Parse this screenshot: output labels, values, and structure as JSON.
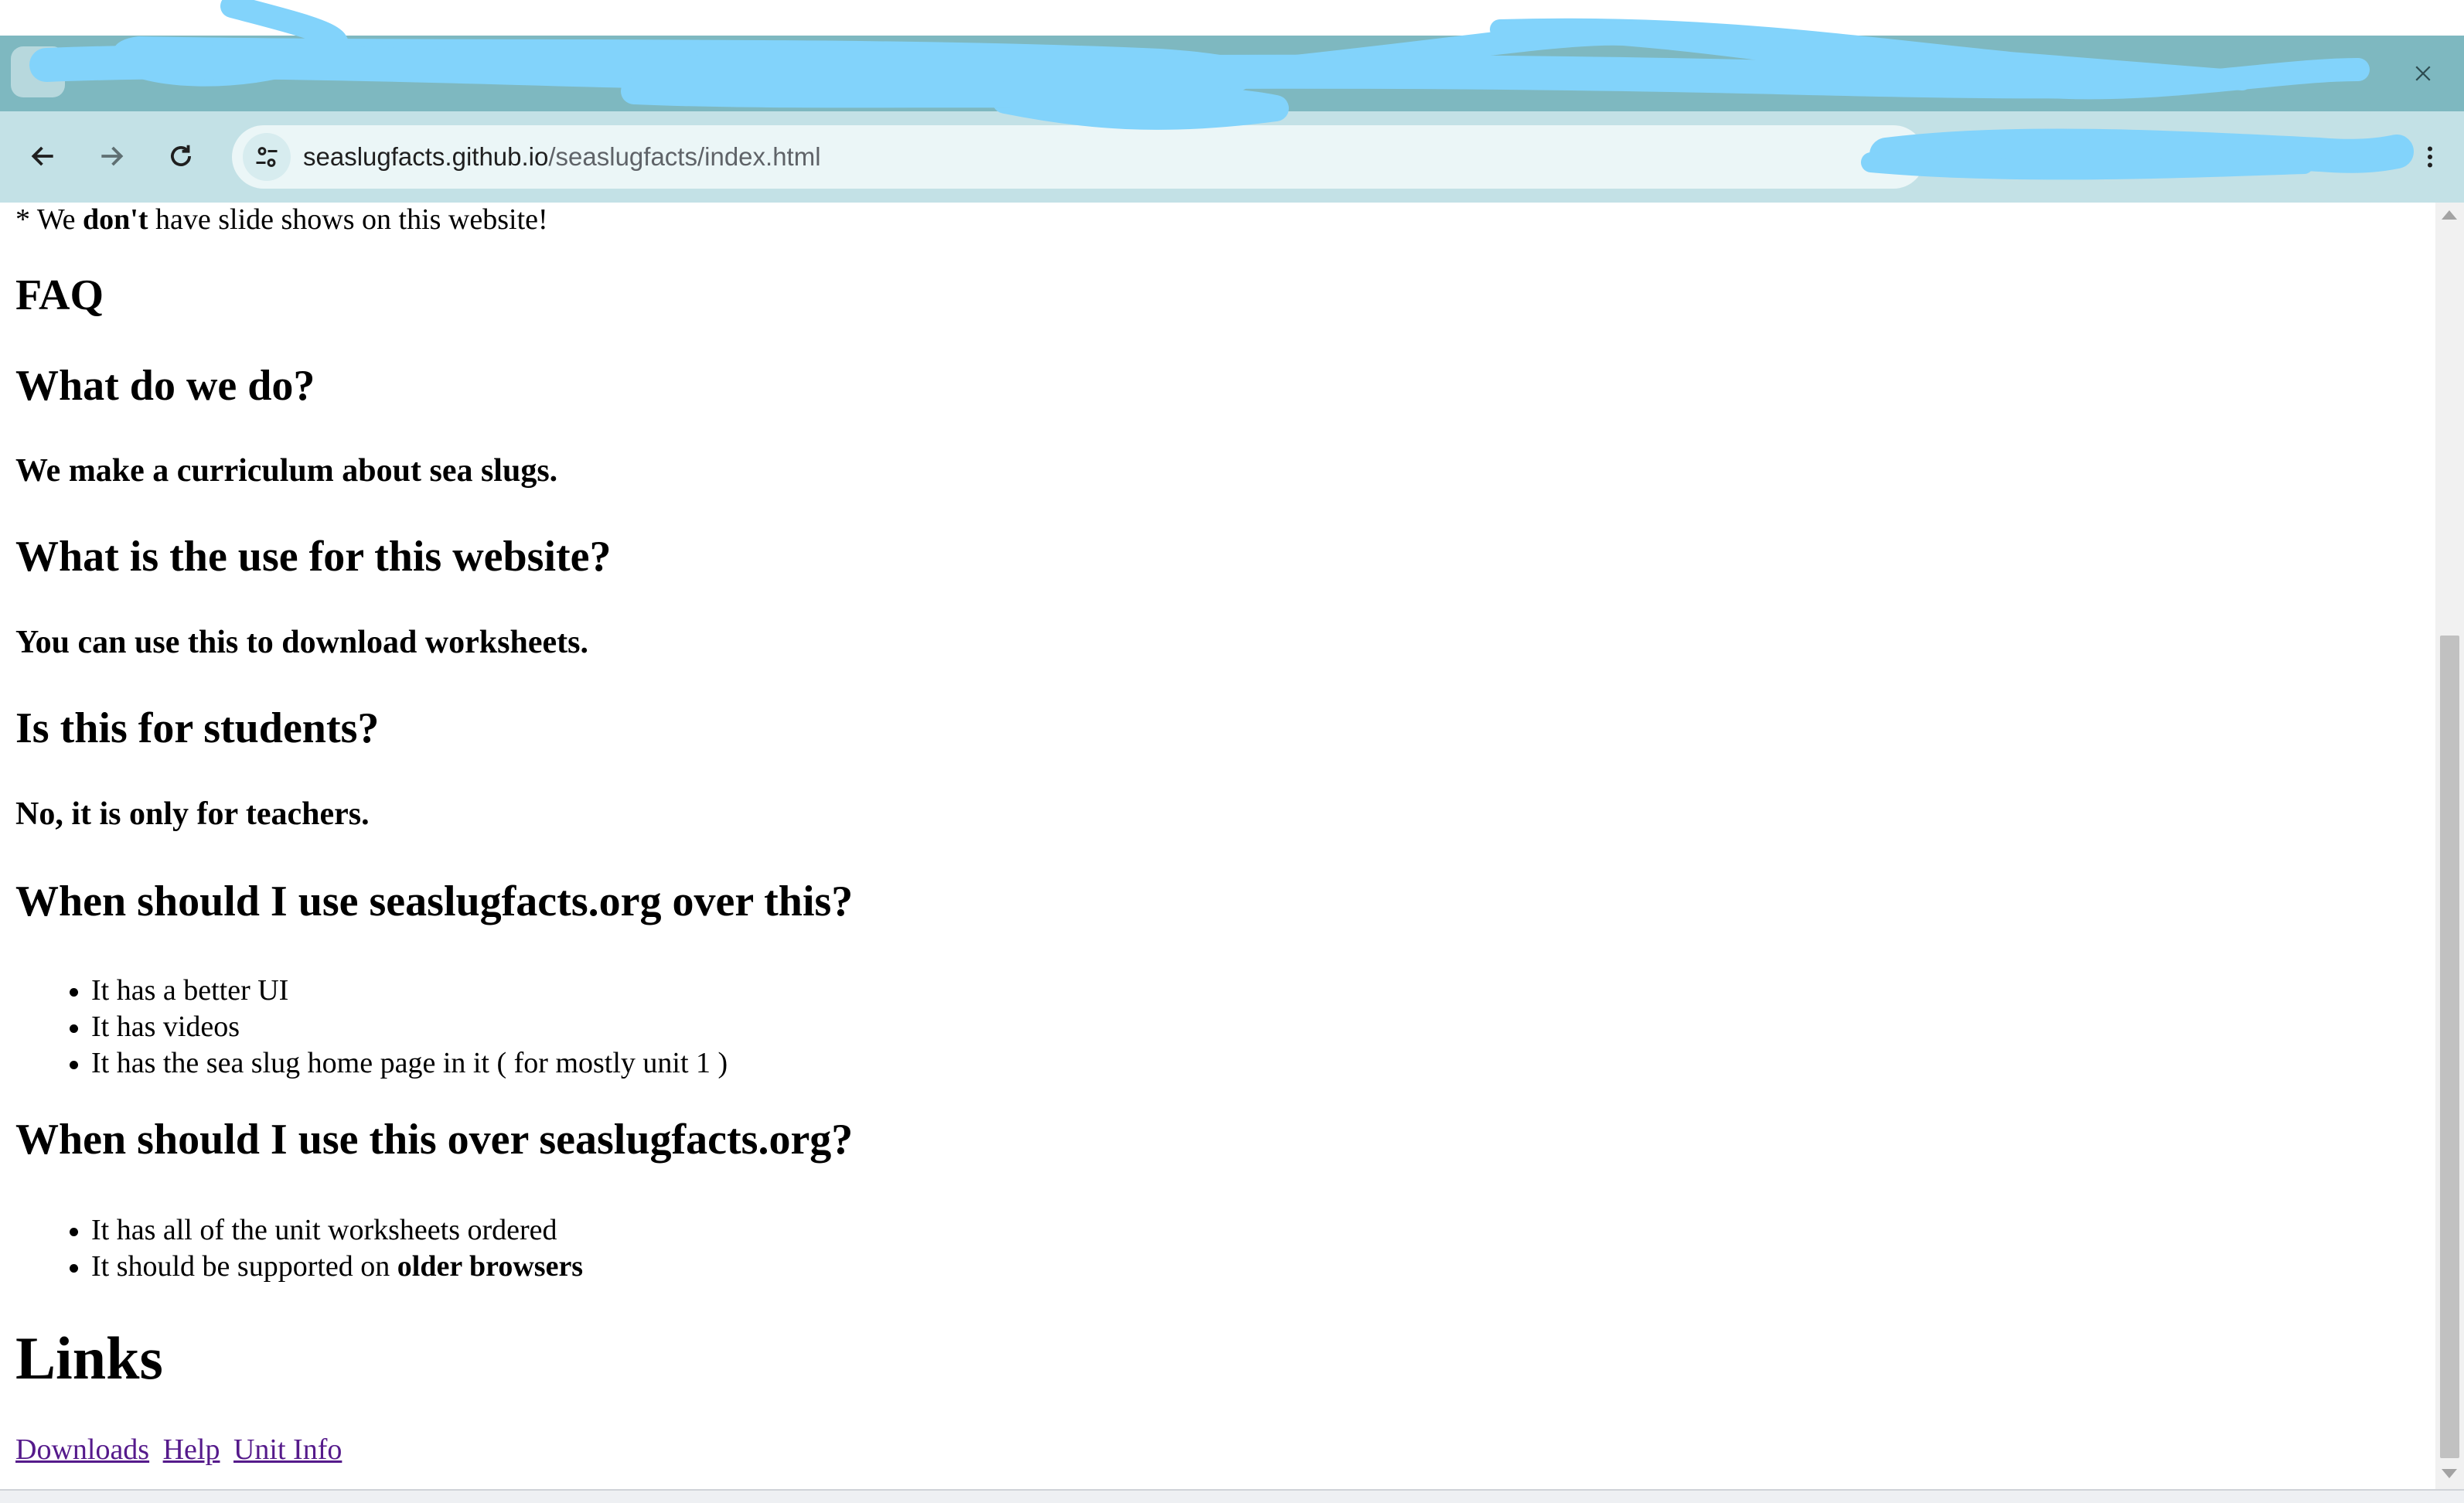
{
  "browser": {
    "url_host": "seaslugfacts.github.io",
    "url_path": "/seaslugfacts/index.html",
    "icons": {
      "tab_search": "chevron-down-icon",
      "back": "arrow-left-icon",
      "forward": "arrow-right-icon",
      "reload": "reload-icon",
      "site_info": "tune-icon",
      "extensions": "puzzle-icon",
      "menu": "kebab-menu-icon",
      "minimize": "minimize-icon",
      "maximize": "restore-icon",
      "close": "close-icon"
    },
    "colors": {
      "tabstrip": "#7eb8c0",
      "toolbar": "#c3e1e6",
      "omnibox": "#ebf6f7",
      "redaction": "#82d3fb"
    }
  },
  "page": {
    "note_prefix": "* We ",
    "note_bold": "don't",
    "note_suffix": " have slide shows on this website!",
    "faq_heading": "FAQ",
    "faq": [
      {
        "question": "What do we do?",
        "answer": "We make a curriculum about sea slugs."
      },
      {
        "question": "What is the use for this website?",
        "answer": "You can use this to download worksheets."
      },
      {
        "question": "Is this for students?",
        "answer": "No, it is only for teachers."
      }
    ],
    "seaslug_org_heading": "When should I use seaslugfacts.org over this?",
    "seaslug_org_items": [
      "It has a better UI",
      "It has videos",
      "It has the sea slug home page in it ( for mostly unit 1 )"
    ],
    "this_site_heading": "When should I use this over seaslugfacts.org?",
    "this_site_item_1": "It has all of the unit worksheets ordered",
    "this_site_item_2_prefix": "It should be supported on ",
    "this_site_item_2_bold": "older browsers",
    "links_heading": "Links",
    "links": [
      "Downloads",
      "Help",
      "Unit Info"
    ]
  }
}
